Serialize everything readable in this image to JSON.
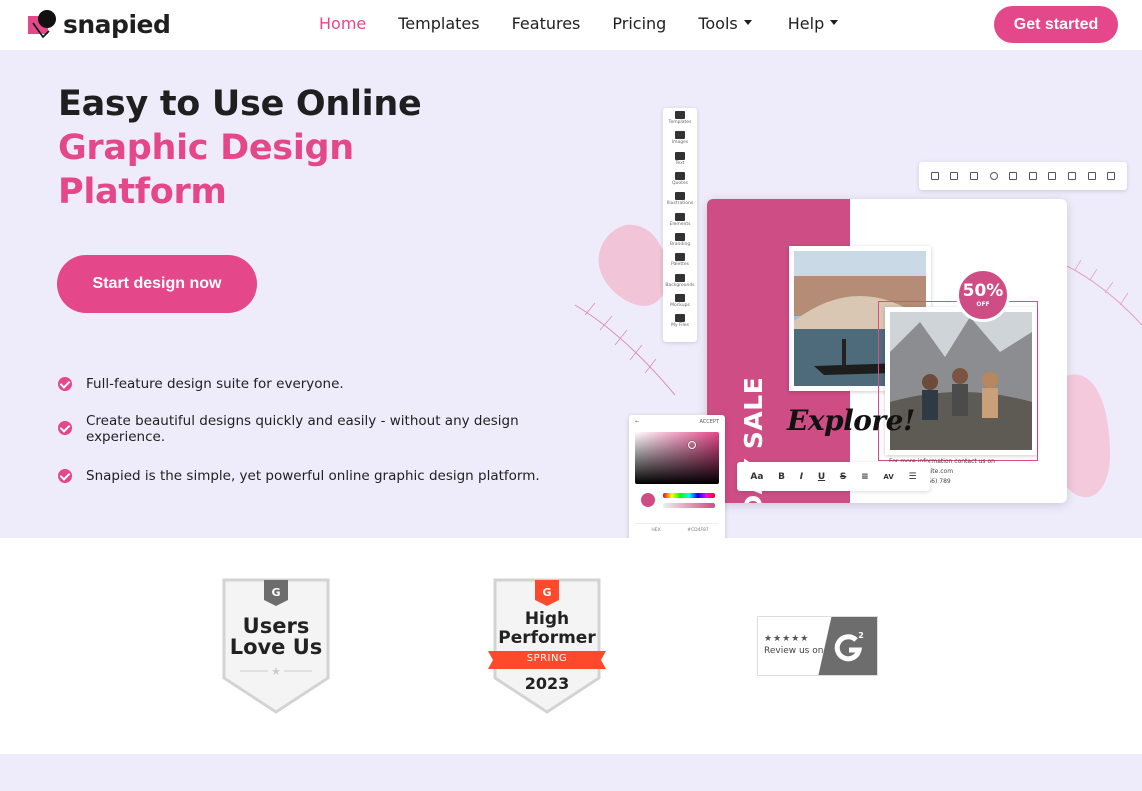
{
  "nav": {
    "logo_text": "snapied",
    "links": [
      {
        "label": "Home"
      },
      {
        "label": "Templates"
      },
      {
        "label": "Features"
      },
      {
        "label": "Pricing"
      },
      {
        "label": "Tools"
      },
      {
        "label": "Help"
      }
    ],
    "cta": "Get started"
  },
  "hero": {
    "title_line1": "Easy to Use Online",
    "title_line2": "Graphic Design",
    "title_line3": "Platform",
    "button": "Start design now",
    "features": [
      "Full-feature design suite for everyone.",
      "Create beautiful designs quickly and easily - without any design experience.",
      "Snapied is the simple, yet powerful online graphic design platform."
    ]
  },
  "mockup": {
    "sidebar_items": [
      "Templates",
      "Images",
      "Text",
      "Quotes",
      "Illustrations",
      "Elements",
      "Branding",
      "Palettes",
      "Backgrounds",
      "Mockups",
      "My Files"
    ],
    "card": {
      "headline": "HOLIDAY SALE",
      "badge_pct": "50%",
      "badge_off": "OFF",
      "script": "Explore!",
      "info_title": "For more information contact us on",
      "website": "www.website.com",
      "phone": "+0123 (456) 789"
    },
    "picker": {
      "accept": "ACCEPT",
      "hex_label": "HEX",
      "hex_value": "#CD4F87"
    },
    "text_toolbar": [
      "Aa",
      "B",
      "I",
      "U",
      "S",
      "AV"
    ]
  },
  "awards": {
    "users_love_us_line1": "Users",
    "users_love_us_line2": "Love Us",
    "high_performer_line1": "High",
    "high_performer_line2": "Performer",
    "season": "SPRING",
    "year": "2023",
    "stars": "★★★★★",
    "review_text": "Review us on"
  },
  "colors": {
    "brand": "#e4478a",
    "hero_bg": "#eeecfb",
    "card_pink": "#cf4d85",
    "g2_red": "#ff492c"
  }
}
